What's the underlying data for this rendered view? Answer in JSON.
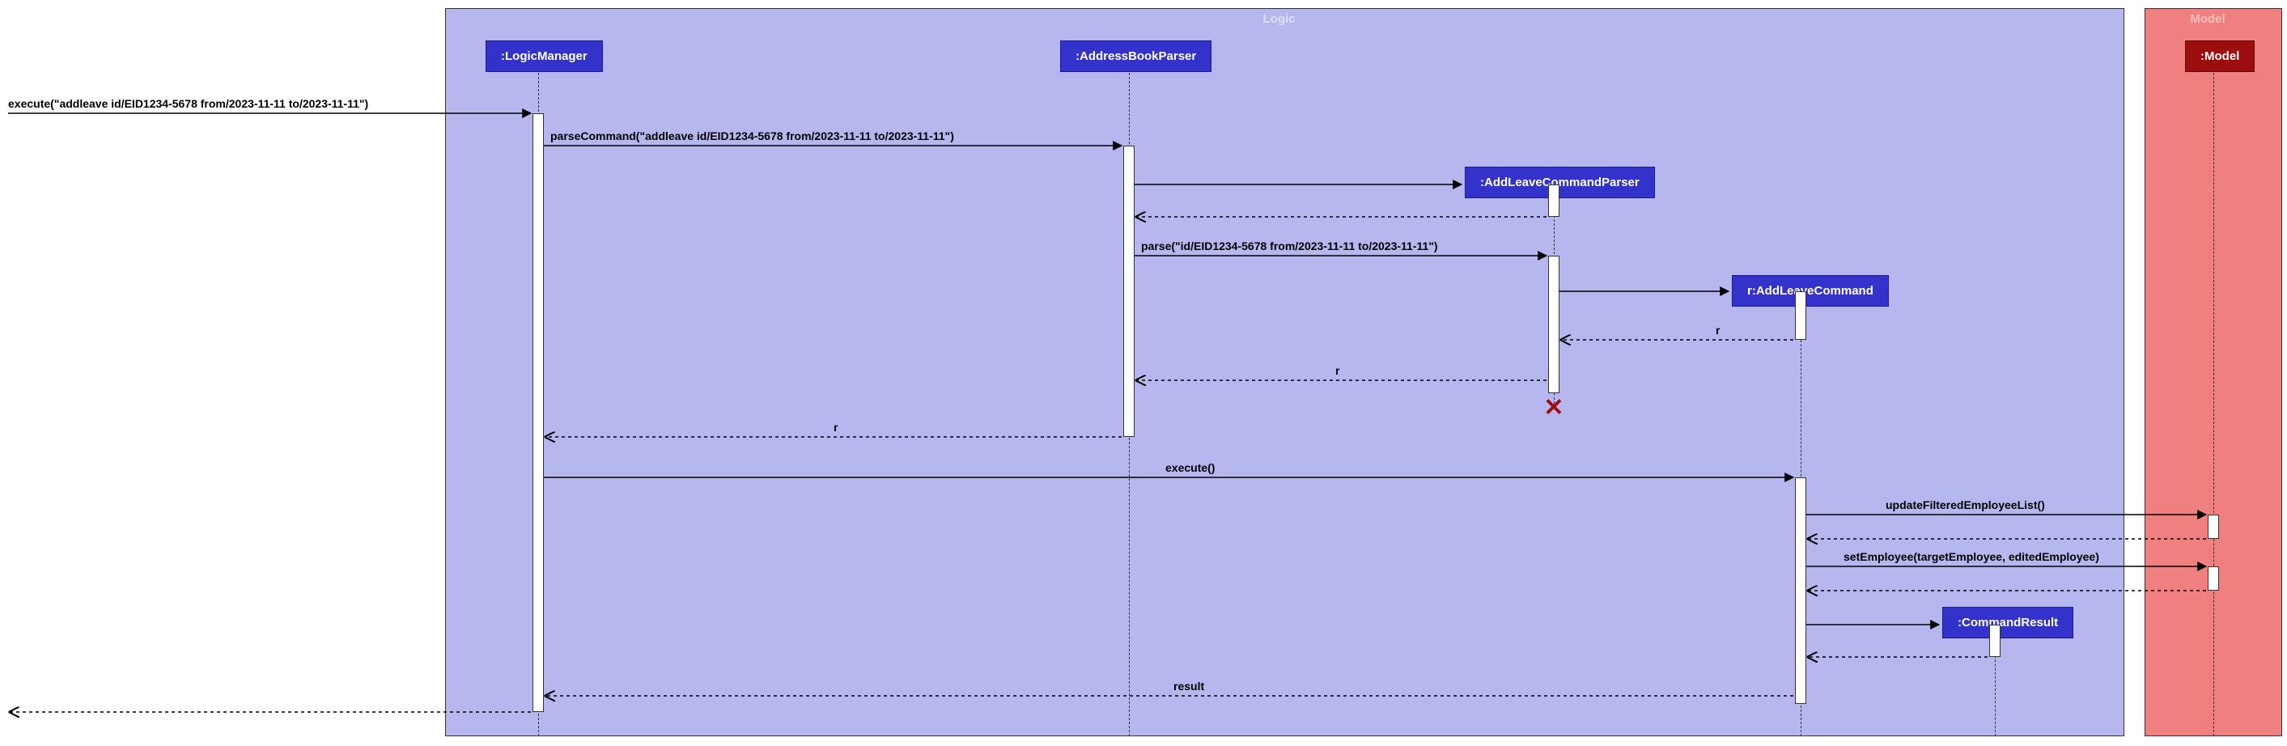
{
  "frames": {
    "logic": {
      "title": "Logic"
    },
    "model": {
      "title": "Model"
    }
  },
  "participants": {
    "logicManager": ":LogicManager",
    "addressBookParser": ":AddressBookParser",
    "addLeaveParser": ":AddLeaveCommandParser",
    "addLeaveCmd": "r:AddLeaveCommand",
    "cmdResult": ":CommandResult",
    "model": ":Model"
  },
  "messages": {
    "m1": "execute(\"addleave id/EID1234-5678 from/2023-11-11 to/2023-11-11\")",
    "m2": "parseCommand(\"addleave id/EID1234-5678 from/2023-11-11 to/2023-11-11\")",
    "m3": "parse(\"id/EID1234-5678 from/2023-11-11 to/2023-11-11\")",
    "m4": "r",
    "m5": "r",
    "m6": "r",
    "m7": "execute()",
    "m8": "updateFilteredEmployeeList()",
    "m9": "setEmployee(targetEmployee, editedEmployee)",
    "m10": "result"
  }
}
